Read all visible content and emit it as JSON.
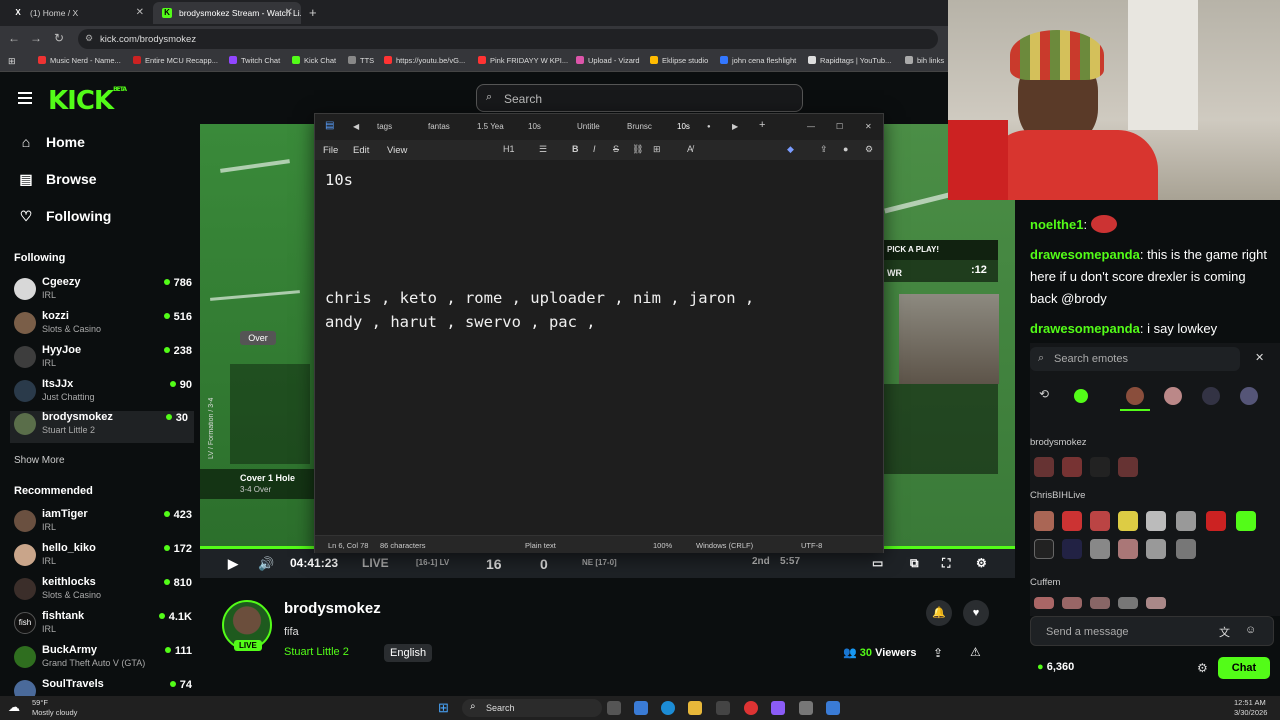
{
  "browser": {
    "tabs": [
      {
        "icon": "X",
        "label": "(1) Home / X"
      },
      {
        "icon": "K",
        "label": "brodysmokez Stream - Watch Li..."
      }
    ],
    "url": "kick.com/brodysmokez",
    "bookmarks": [
      "Music Nerd - Name...",
      "Entire MCU Recapp...",
      "Twitch Chat",
      "Kick Chat",
      "TTS",
      "https://youtu.be/vG...",
      "Pink FRIDAYY W KPI...",
      "Upload - Vizard",
      "Eklipse studio",
      "john cena fleshlight",
      "Rapidtags | YouTub...",
      "bih links"
    ]
  },
  "kick": {
    "logo": "KICK",
    "logo_tag": "BETA",
    "search_placeholder": "Search",
    "nav": [
      {
        "icon": "home-icon",
        "label": "Home"
      },
      {
        "icon": "browse-icon",
        "label": "Browse"
      },
      {
        "icon": "heart-icon",
        "label": "Following"
      }
    ],
    "following_title": "Following",
    "following": [
      {
        "name": "Cgeezy",
        "category": "IRL",
        "viewers": "786"
      },
      {
        "name": "kozzi",
        "category": "Slots & Casino",
        "viewers": "516"
      },
      {
        "name": "HyyJoe",
        "category": "IRL",
        "viewers": "238"
      },
      {
        "name": "ItsJJx",
        "category": "Just Chatting",
        "viewers": "90"
      },
      {
        "name": "brodysmokez",
        "category": "Stuart Little 2",
        "viewers": "30"
      }
    ],
    "show_more": "Show More",
    "recommended_title": "Recommended",
    "recommended": [
      {
        "name": "iamTiger",
        "category": "IRL",
        "viewers": "423"
      },
      {
        "name": "hello_kiko",
        "category": "IRL",
        "viewers": "172"
      },
      {
        "name": "keithlocks",
        "category": "Slots & Casino",
        "viewers": "810"
      },
      {
        "name": "fishtank",
        "category": "IRL",
        "viewers": "4.1K"
      },
      {
        "name": "BuckArmy",
        "category": "Grand Theft Auto V (GTA)",
        "viewers": "111"
      },
      {
        "name": "SoulTravels",
        "category": "",
        "viewers": "74"
      }
    ]
  },
  "player": {
    "time": "04:41:23",
    "live": "LIVE",
    "score_away_rec": "[16-1] LV",
    "score_away": "16",
    "score_home": "0",
    "score_home_rec": "NE [17-0]",
    "quarter": "2nd",
    "clock": "5:57",
    "game_overlay": {
      "play_title": "PICK A PLAY!",
      "play_clock": ":12",
      "team": "WR",
      "over": "Over",
      "formation": "LV / Formation / 3-4",
      "cover": "Cover 1 Hole",
      "cover_sub": "3-4 Over"
    }
  },
  "notepad": {
    "tabs": [
      "tags",
      "fantas",
      "1.5 Yea",
      "10s",
      "Untitle",
      "Brunsc",
      "10s"
    ],
    "menu": [
      "File",
      "Edit",
      "View"
    ],
    "toolbar": {
      "heading": "H1"
    },
    "lines": [
      "10s",
      "chris , keto , rome , uploader , nim , jaron ,",
      "andy , harut , swervo , pac ,"
    ],
    "status": {
      "position": "Ln 6, Col 78",
      "chars": "86 characters",
      "type": "Plain text",
      "zoom": "100%",
      "eol": "Windows (CRLF)",
      "encoding": "UTF-8"
    }
  },
  "stream": {
    "name": "brodysmokez",
    "title": "fifa",
    "category": "Stuart Little 2",
    "language": "English",
    "live_badge": "LIVE",
    "viewers_count": "30",
    "viewers_label": "Viewers"
  },
  "chat": {
    "messages": [
      {
        "user": "noelthe1",
        "text": ""
      },
      {
        "user": "drawesomepanda",
        "text": "this is the game right here if u don't score drexler is coming back @brody"
      },
      {
        "user": "drawesomepanda",
        "text": "i say lowkey"
      }
    ],
    "emote_search_placeholder": "Search emotes",
    "emote_groups": [
      "brodysmokez",
      "ChrisBIHLive",
      "Cuffem"
    ],
    "send_placeholder": "Send a message",
    "points": "6,360",
    "chat_button": "Chat"
  },
  "taskbar": {
    "weather_temp": "59°F",
    "weather_desc": "Mostly cloudy",
    "search": "Search",
    "time": "12:51 AM",
    "date": "3/30/2026"
  }
}
